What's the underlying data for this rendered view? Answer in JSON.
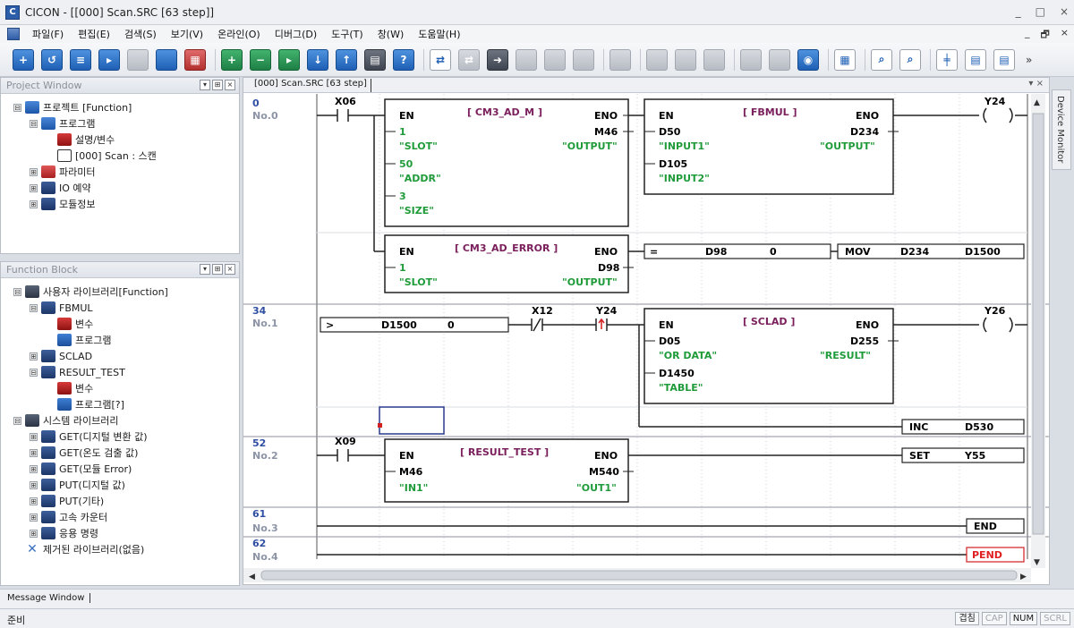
{
  "window": {
    "app_name": "CICON",
    "title": "CICON - [[000] Scan.SRC [63 step]]",
    "controls": [
      "_",
      "□",
      "×"
    ]
  },
  "menubar": {
    "items": [
      "파일(F)",
      "편집(E)",
      "검색(S)",
      "보기(V)",
      "온라인(O)",
      "디버그(D)",
      "도구(T)",
      "창(W)",
      "도움말(H)"
    ],
    "right_controls": [
      "_",
      "🗗",
      "×"
    ]
  },
  "toolbar": {
    "overflow": "»"
  },
  "project_window": {
    "title": "Project Window",
    "items": [
      {
        "label": "프로젝트 [Function]",
        "level": 0,
        "icon": "project-icon",
        "expander": "⊟"
      },
      {
        "label": "프로그램",
        "level": 1,
        "icon": "folder-icon",
        "expander": "⊟"
      },
      {
        "label": "설명/변수",
        "level": 2,
        "icon": "variable-icon",
        "expander": ""
      },
      {
        "label": "[000] Scan : 스캔",
        "level": 2,
        "icon": "ladder-icon",
        "expander": ""
      },
      {
        "label": "파라미터",
        "level": 1,
        "icon": "parameter-icon",
        "expander": "⊞"
      },
      {
        "label": "IO 예약",
        "level": 1,
        "icon": "io-icon",
        "expander": "⊞"
      },
      {
        "label": "모듈정보",
        "level": 1,
        "icon": "module-icon",
        "expander": "⊞"
      }
    ]
  },
  "function_block": {
    "title": "Function Block",
    "items": [
      {
        "label": "사용자 라이브러리[Function]",
        "level": 0,
        "icon": "library-icon",
        "expander": "⊟"
      },
      {
        "label": "FBMUL",
        "level": 1,
        "icon": "function-block-icon",
        "expander": "⊟"
      },
      {
        "label": "변수",
        "level": 2,
        "icon": "variable-icon",
        "expander": ""
      },
      {
        "label": "프로그램",
        "level": 2,
        "icon": "program-icon",
        "expander": ""
      },
      {
        "label": "SCLAD",
        "level": 1,
        "icon": "function-block-icon",
        "expander": "⊞"
      },
      {
        "label": "RESULT_TEST",
        "level": 1,
        "icon": "function-block-icon",
        "expander": "⊟"
      },
      {
        "label": "변수",
        "level": 2,
        "icon": "variable-icon",
        "expander": ""
      },
      {
        "label": "프로그램[?]",
        "level": 2,
        "icon": "program-icon",
        "expander": ""
      },
      {
        "label": "시스템 라이브러리",
        "level": 0,
        "icon": "library-icon",
        "expander": "⊟"
      },
      {
        "label": "GET(디지털 변환 값)",
        "level": 1,
        "icon": "function-block-icon",
        "expander": "⊞"
      },
      {
        "label": "GET(온도 검출 값)",
        "level": 1,
        "icon": "function-block-icon",
        "expander": "⊞"
      },
      {
        "label": "GET(모듈 Error)",
        "level": 1,
        "icon": "function-block-icon",
        "expander": "⊞"
      },
      {
        "label": "PUT(디지털 값)",
        "level": 1,
        "icon": "function-block-icon",
        "expander": "⊞"
      },
      {
        "label": "PUT(기타)",
        "level": 1,
        "icon": "function-block-icon",
        "expander": "⊞"
      },
      {
        "label": "고속 카운터",
        "level": 1,
        "icon": "function-block-icon",
        "expander": "⊞"
      },
      {
        "label": "응용 명령",
        "level": 1,
        "icon": "function-block-icon",
        "expander": "⊞"
      },
      {
        "label": "제거된 라이브러리(없음)",
        "level": 0,
        "icon": "removed-library-icon",
        "expander": ""
      }
    ]
  },
  "editor": {
    "tab": "[000] Scan.SRC [63 step]",
    "tab_controls": "▾ ×",
    "rungs": [
      {
        "step": "0",
        "no": "No.0"
      },
      {
        "step": "34",
        "no": "No.1"
      },
      {
        "step": "52",
        "no": "No.2"
      },
      {
        "step": "61",
        "no": "No.3"
      },
      {
        "step": "62",
        "no": "No.4"
      }
    ],
    "contacts": {
      "x06": "X06",
      "x12": "X12",
      "y24_contact": "Y24",
      "x09": "X09"
    },
    "coils": {
      "y24": "Y24",
      "y26": "Y26",
      "coil_glyph": "( )"
    },
    "blocks": {
      "cm3_ad_m": {
        "name": "[ CM3_AD_M ]",
        "en": "EN",
        "eno": "ENO",
        "out": "M46",
        "out_label": "\"OUTPUT\"",
        "inputs": [
          "1",
          "\"SLOT\"",
          "50",
          "\"ADDR\"",
          "3",
          "\"SIZE\""
        ]
      },
      "fbmul": {
        "name": "[ FBMUL ]",
        "en": "EN",
        "eno": "ENO",
        "out": "D234",
        "out_label": "\"OUTPUT\"",
        "inputs": [
          "D50",
          "\"INPUT1\"",
          "D105",
          "\"INPUT2\""
        ]
      },
      "cm3_ad_error": {
        "name": "[ CM3_AD_ERROR ]",
        "en": "EN",
        "eno": "ENO",
        "out": "D98",
        "out_label": "\"OUTPUT\"",
        "inputs": [
          "1",
          "\"SLOT\""
        ]
      },
      "sclad": {
        "name": "[ SCLAD ]",
        "en": "EN",
        "eno": "ENO",
        "out": "D255",
        "out_label": "\"RESULT\"",
        "inputs": [
          "D05",
          "\"OR DATA\"",
          "D1450",
          "\"TABLE\""
        ]
      },
      "result_test": {
        "name": "[ RESULT_TEST ]",
        "en": "EN",
        "eno": "ENO",
        "out": "M540",
        "out_label": "\"OUT1\"",
        "inputs": [
          "M46",
          "\"IN1\""
        ]
      }
    },
    "instructions": {
      "cmp_eq": {
        "op": "=",
        "a": "D98",
        "b": "0"
      },
      "mov": {
        "op": "MOV",
        "a": "D234",
        "b": "D1500"
      },
      "cmp_gt": {
        "op": ">",
        "a": "D1500",
        "b": "0"
      },
      "inc": {
        "op": "INC",
        "a": "D530"
      },
      "set": {
        "op": "SET",
        "a": "Y55"
      },
      "end": "END",
      "pend": "PEND"
    }
  },
  "device_monitor": "Device Monitor",
  "message_window": "Message Window",
  "status": {
    "text": "준비",
    "cells": [
      "겹침",
      "CAP",
      "NUM",
      "SCRL"
    ]
  },
  "colors": {
    "block_name": "#7a1f5c",
    "string_label": "#1f9b3a",
    "rung_number": "#2f4fa3",
    "pend": "#e02020",
    "selection": "#2a3a8c"
  }
}
